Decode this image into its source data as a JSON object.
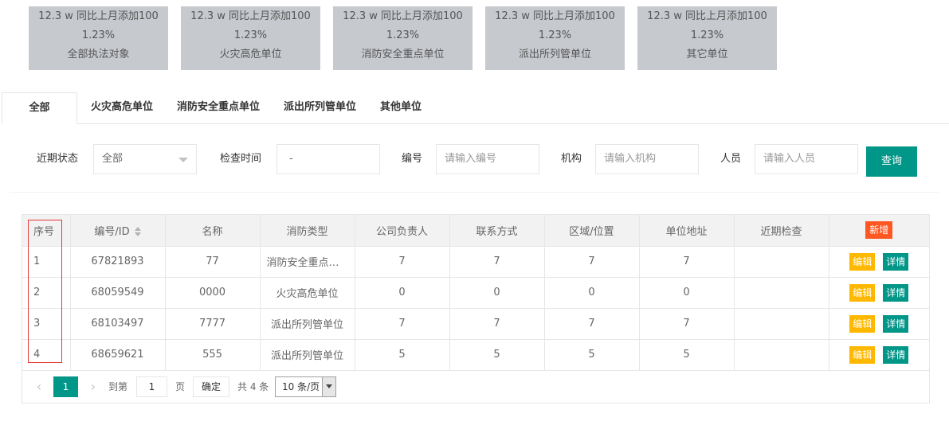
{
  "stats": [
    {
      "line1": "12.3 w 同比上月添加100",
      "line2": "1.23%",
      "label": "全部执法对象"
    },
    {
      "line1": "12.3 w 同比上月添加100",
      "line2": "1.23%",
      "label": "火灾高危单位"
    },
    {
      "line1": "12.3 w 同比上月添加100",
      "line2": "1.23%",
      "label": "消防安全重点单位"
    },
    {
      "line1": "12.3 w 同比上月添加100",
      "line2": "1.23%",
      "label": "派出所列管单位"
    },
    {
      "line1": "12.3 w 同比上月添加100",
      "line2": "1.23%",
      "label": "其它单位"
    }
  ],
  "tabs": [
    "全部",
    "火灾高危单位",
    "消防安全重点单位",
    "派出所列管单位",
    "其他单位"
  ],
  "filters": {
    "status_label": "近期状态",
    "status_value": "全部",
    "time_label": "检查时间",
    "time_value": "-",
    "id_label": "编号",
    "id_placeholder": "请输入编号",
    "org_label": "机构",
    "org_placeholder": "请输入机构",
    "person_label": "人员",
    "person_placeholder": "请输入人员",
    "query_label": "查询"
  },
  "table": {
    "headers": [
      "序号",
      "编号/ID",
      "名称",
      "消防类型",
      "公司负责人",
      "联系方式",
      "区域/位置",
      "单位地址",
      "近期检查"
    ],
    "add_label": "新增",
    "edit_label": "编辑",
    "detail_label": "详情",
    "rows": [
      [
        "1",
        "67821893",
        "77",
        "消防安全重点单位",
        "7",
        "7",
        "7",
        "7",
        ""
      ],
      [
        "2",
        "68059549",
        "0000",
        "火灾高危单位",
        "0",
        "0",
        "0",
        "0",
        ""
      ],
      [
        "3",
        "68103497",
        "7777",
        "派出所列管单位",
        "7",
        "7",
        "7",
        "7",
        ""
      ],
      [
        "4",
        "68659621",
        "555",
        "派出所列管单位",
        "5",
        "5",
        "5",
        "5",
        ""
      ]
    ]
  },
  "pager": {
    "prev": "‹",
    "current": "1",
    "next": "›",
    "goto_label": "到第",
    "goto_value": "1",
    "page_label": "页",
    "confirm_label": "确定",
    "total_label": "共 4 条",
    "size_label": "10 条/页"
  }
}
